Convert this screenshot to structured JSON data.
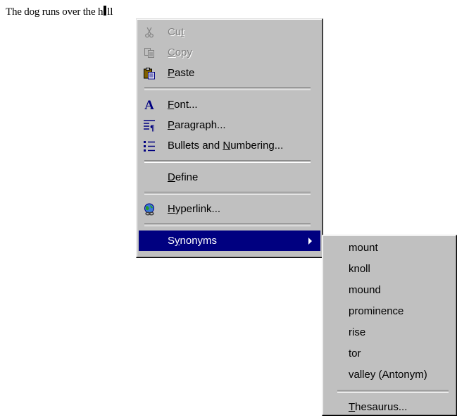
{
  "document": {
    "text_before": "The dog runs over the h",
    "text_after": "ll"
  },
  "context_menu": {
    "items": [
      {
        "pre": "Cu",
        "ul": "t",
        "post": "",
        "icon": "scissors-icon",
        "enabled": false
      },
      {
        "pre": "",
        "ul": "C",
        "post": "opy",
        "icon": "copy-icon",
        "enabled": false
      },
      {
        "pre": "",
        "ul": "P",
        "post": "aste",
        "icon": "paste-icon",
        "enabled": true
      },
      {
        "pre": "",
        "ul": "F",
        "post": "ont...",
        "icon": "font-icon",
        "enabled": true
      },
      {
        "pre": "",
        "ul": "P",
        "post": "aragraph...",
        "icon": "paragraph-icon",
        "enabled": true
      },
      {
        "pre": "Bullets and ",
        "ul": "N",
        "post": "umbering...",
        "icon": "bullets-icon",
        "enabled": true
      },
      {
        "pre": "",
        "ul": "D",
        "post": "efine",
        "icon": "",
        "enabled": true
      },
      {
        "pre": "",
        "ul": "H",
        "post": "yperlink...",
        "icon": "hyperlink-globe-icon",
        "enabled": true
      },
      {
        "pre": "S",
        "ul": "y",
        "post": "nonyms",
        "icon": "",
        "enabled": true,
        "submenu": true
      }
    ]
  },
  "synonyms_menu": {
    "items": [
      "mount",
      "knoll",
      "mound",
      "prominence",
      "rise",
      "tor",
      "valley (Antonym)"
    ],
    "thesaurus": {
      "pre": "",
      "ul": "T",
      "post": "hesaurus..."
    }
  },
  "colors": {
    "menu_bg": "#c0c0c0",
    "highlight": "#000080"
  }
}
